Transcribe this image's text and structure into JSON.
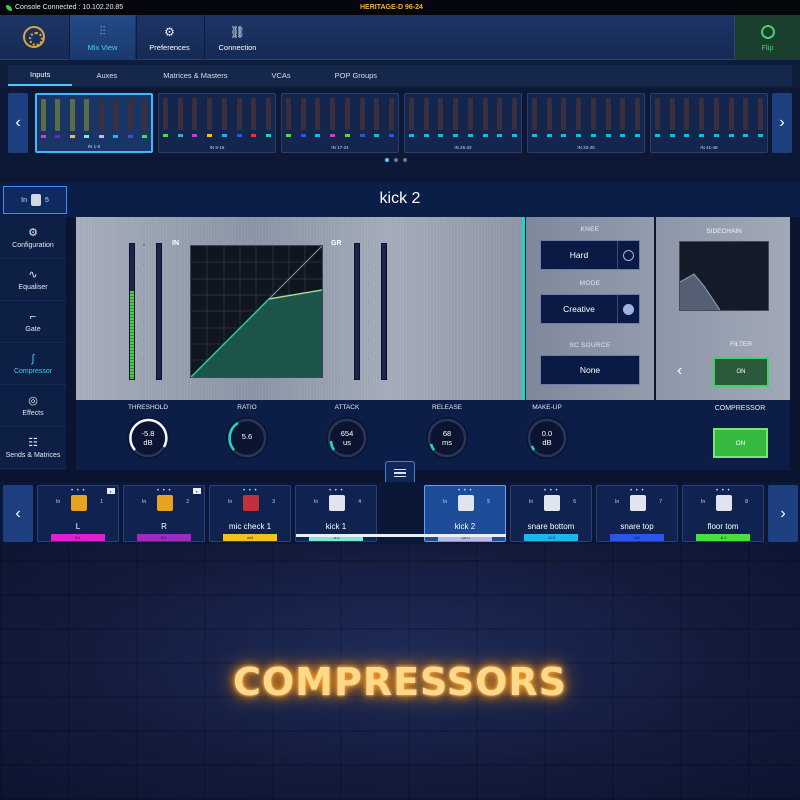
{
  "status": {
    "connection": "Console Connected : 10.102.20.85",
    "console_name": "HERITAGE-D 96-24"
  },
  "topbar": {
    "buttons": [
      {
        "label": "Mix View",
        "icon": "faders-icon",
        "active": true
      },
      {
        "label": "Preferences",
        "icon": "settings-sliders-icon",
        "active": false
      },
      {
        "label": "Connection",
        "icon": "link-icon",
        "active": false
      }
    ],
    "flip": "Flip"
  },
  "tabs": [
    "Inputs",
    "Auxes",
    "Matrices & Masters",
    "VCAs",
    "POP Groups"
  ],
  "banks": [
    {
      "label": "IN 1-8"
    },
    {
      "label": "IN 9-16"
    },
    {
      "label": "IN 17-24"
    },
    {
      "label": "IN 25-32"
    },
    {
      "label": "IN 33-40"
    },
    {
      "label": "IN 41-48"
    }
  ],
  "channel": {
    "badge_prefix": "In",
    "badge_number": "5",
    "name": "kick 2"
  },
  "sidebar": [
    {
      "label": "Configuration",
      "icon": "gears-icon"
    },
    {
      "label": "Equaliser",
      "icon": "eq-icon"
    },
    {
      "label": "Gate",
      "icon": "gate-icon"
    },
    {
      "label": "Compressor",
      "icon": "compressor-icon",
      "active": true
    },
    {
      "label": "Effects",
      "icon": "effects-icon"
    },
    {
      "label": "Sends & Matrices",
      "icon": "sends-icon"
    }
  ],
  "graph": {
    "in_label": "IN",
    "gr_label": "GR"
  },
  "controls": {
    "knee_label": "KNEE",
    "knee_value": "Hard",
    "mode_label": "MODE",
    "mode_value": "Creative",
    "sc_source_label": "SC SOURCE",
    "sc_source_value": "None",
    "sidechain_label": "SIDECHAIN",
    "filter_label": "FILTER",
    "filter_state": "ON"
  },
  "knobs": [
    {
      "label": "THRESHOLD",
      "value": "-5.8",
      "unit": "dB"
    },
    {
      "label": "RATIO",
      "value": "5.6",
      "unit": ""
    },
    {
      "label": "ATTACK",
      "value": "654",
      "unit": "us"
    },
    {
      "label": "RELEASE",
      "value": "68",
      "unit": "ms"
    },
    {
      "label": "MAKE-UP",
      "value": "0.0",
      "unit": "dB"
    }
  ],
  "compressor": {
    "label": "COMPRESSOR",
    "state": "ON"
  },
  "strip": [
    {
      "name": "L",
      "prefix": "In",
      "num": "1",
      "bar": "8.1",
      "color": "#e21fd0",
      "icon_color": "#e8a21f"
    },
    {
      "name": "R",
      "prefix": "In",
      "num": "2",
      "bar": "8.1",
      "color": "#9c2bc0",
      "icon_color": "#e8a21f"
    },
    {
      "name": "mic check 1",
      "prefix": "In",
      "num": "3",
      "bar": "def",
      "color": "#f2c21a",
      "icon_color": "#c2303a"
    },
    {
      "name": "kick 1",
      "prefix": "In",
      "num": "4",
      "bar": "-4.0",
      "color": "#7fe8d8",
      "icon_color": "#dfe4ee"
    },
    {
      "name": "kick 2",
      "prefix": "In",
      "num": "5",
      "bar": "-10.0",
      "color": "#b9b9ea",
      "icon_color": "#dfe4ee"
    },
    {
      "name": "snare bottom",
      "prefix": "In",
      "num": "6",
      "bar": "-11.5",
      "color": "#19b9f0",
      "icon_color": "#dfe4ee"
    },
    {
      "name": "snare top",
      "prefix": "In",
      "num": "7",
      "bar": "def",
      "color": "#2a55e6",
      "icon_color": "#dfe4ee"
    },
    {
      "name": "floor tom",
      "prefix": "In",
      "num": "8",
      "bar": "-6.2",
      "color": "#49e03e",
      "icon_color": "#dfe4ee"
    }
  ],
  "promo": {
    "title": "COMPRESSORS"
  }
}
